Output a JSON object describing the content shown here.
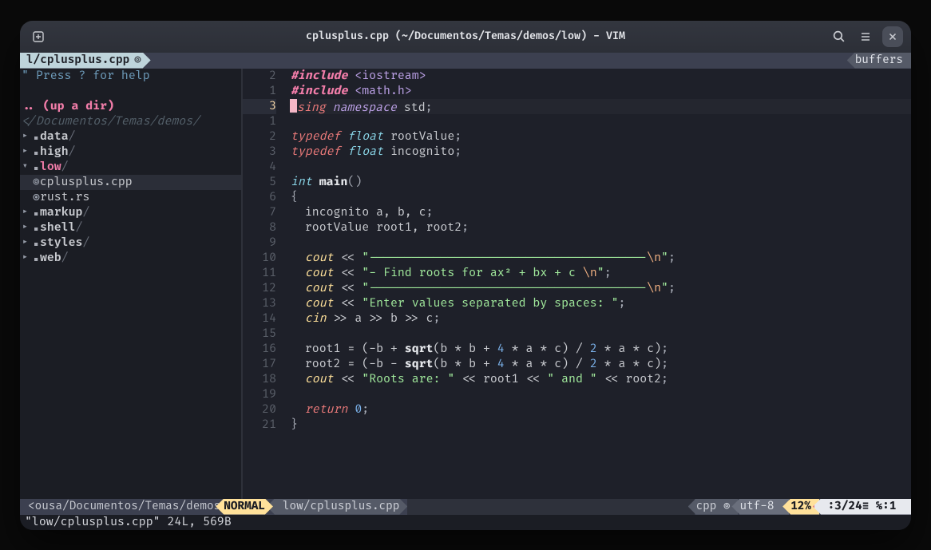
{
  "titlebar": {
    "title": "cplusplus.cpp (~/Documentos/Temas/demos/low) - VIM"
  },
  "tab": {
    "label": "l/cplusplus.cpp"
  },
  "buffers_label": "buffers",
  "sidebar": {
    "help": "\" Press ? for help",
    "up_label": ".. (up a dir)",
    "cwd_comment": "</Documentos/Temas/demos/",
    "items": [
      {
        "name": "data",
        "type": "folder",
        "open": false
      },
      {
        "name": "high",
        "type": "folder",
        "open": false
      },
      {
        "name": "low",
        "type": "folder",
        "open": true,
        "children": [
          {
            "name": "cplusplus.cpp",
            "type": "file",
            "sel": true,
            "ico": "⊚"
          },
          {
            "name": "rust.rs",
            "type": "file",
            "ico": "◉"
          }
        ]
      },
      {
        "name": "markup",
        "type": "folder",
        "open": false
      },
      {
        "name": "shell",
        "type": "folder",
        "open": false
      },
      {
        "name": "styles",
        "type": "folder",
        "open": false
      },
      {
        "name": "web",
        "type": "folder",
        "open": false
      }
    ]
  },
  "gutter": {
    "current_abs": 3,
    "rel": [
      2,
      1,
      "3",
      1,
      2,
      3,
      4,
      5,
      6,
      7,
      8,
      9,
      10,
      11,
      12,
      13,
      14,
      15,
      16,
      17,
      18,
      19,
      20,
      21,
      "",
      "",
      ""
    ]
  },
  "code": {
    "lines": [
      [
        [
          "k-inc",
          "#include"
        ],
        [
          "k-punc",
          " "
        ],
        [
          "k-hdr",
          "<iostream>"
        ]
      ],
      [
        [
          "k-inc",
          "#include"
        ],
        [
          "k-punc",
          " "
        ],
        [
          "k-hdr",
          "<math.h>"
        ]
      ],
      "__CURSOR_LINE__",
      [],
      [
        [
          "k-kw",
          "typedef"
        ],
        [
          "k-punc",
          " "
        ],
        [
          "k-type",
          "float"
        ],
        [
          "k-id",
          " rootValue"
        ],
        [
          "k-punc",
          ";"
        ]
      ],
      [
        [
          "k-kw",
          "typedef"
        ],
        [
          "k-punc",
          " "
        ],
        [
          "k-type",
          "float"
        ],
        [
          "k-id",
          " incognito"
        ],
        [
          "k-punc",
          ";"
        ]
      ],
      [],
      [
        [
          "k-type",
          "int"
        ],
        [
          "k-punc",
          " "
        ],
        [
          "k-fn",
          "main"
        ],
        [
          "k-punc",
          "()"
        ]
      ],
      [
        [
          "k-punc",
          "{"
        ]
      ],
      [
        [
          "k-id",
          "  incognito a, b, c"
        ],
        [
          "k-punc",
          ";"
        ]
      ],
      [
        [
          "k-id",
          "  rootValue root1, root2"
        ],
        [
          "k-punc",
          ";"
        ]
      ],
      [],
      [
        [
          "k-id",
          "  "
        ],
        [
          "k-out",
          "cout"
        ],
        [
          "k-op",
          " << "
        ],
        [
          "k-str",
          "\"---------------------------------------"
        ],
        [
          "k-esc",
          "\\n"
        ],
        [
          "k-str",
          "\""
        ],
        [
          "k-punc",
          ";"
        ]
      ],
      [
        [
          "k-id",
          "  "
        ],
        [
          "k-out",
          "cout"
        ],
        [
          "k-op",
          " << "
        ],
        [
          "k-str",
          "\"- Find roots for ax² + bx + c "
        ],
        [
          "k-esc",
          "\\n"
        ],
        [
          "k-str",
          "\""
        ],
        [
          "k-punc",
          ";"
        ]
      ],
      [
        [
          "k-id",
          "  "
        ],
        [
          "k-out",
          "cout"
        ],
        [
          "k-op",
          " << "
        ],
        [
          "k-str",
          "\"---------------------------------------"
        ],
        [
          "k-esc",
          "\\n"
        ],
        [
          "k-str",
          "\""
        ],
        [
          "k-punc",
          ";"
        ]
      ],
      [
        [
          "k-id",
          "  "
        ],
        [
          "k-out",
          "cout"
        ],
        [
          "k-op",
          " << "
        ],
        [
          "k-str",
          "\"Enter values separated by spaces: \""
        ],
        [
          "k-punc",
          ";"
        ]
      ],
      [
        [
          "k-id",
          "  "
        ],
        [
          "k-out",
          "cin"
        ],
        [
          "k-op",
          " >> a >> b >> c"
        ],
        [
          "k-punc",
          ";"
        ]
      ],
      [],
      [
        [
          "k-id",
          "  root1 = (-b + "
        ],
        [
          "k-fn",
          "sqrt"
        ],
        [
          "k-id",
          "(b * b + "
        ],
        [
          "k-num",
          "4"
        ],
        [
          "k-id",
          " * a * c) / "
        ],
        [
          "k-num",
          "2"
        ],
        [
          "k-id",
          " * a * c)"
        ],
        [
          "k-punc",
          ";"
        ]
      ],
      [
        [
          "k-id",
          "  root2 = (-b - "
        ],
        [
          "k-fn",
          "sqrt"
        ],
        [
          "k-id",
          "(b * b + "
        ],
        [
          "k-num",
          "4"
        ],
        [
          "k-id",
          " * a * c) / "
        ],
        [
          "k-num",
          "2"
        ],
        [
          "k-id",
          " * a * c)"
        ],
        [
          "k-punc",
          ";"
        ]
      ],
      [
        [
          "k-id",
          "  "
        ],
        [
          "k-out",
          "cout"
        ],
        [
          "k-op",
          " << "
        ],
        [
          "k-str",
          "\"Roots are: \""
        ],
        [
          "k-op",
          " << root1 << "
        ],
        [
          "k-str",
          "\" and \""
        ],
        [
          "k-op",
          " << root2"
        ],
        [
          "k-punc",
          ";"
        ]
      ],
      [],
      [
        [
          "k-id",
          "  "
        ],
        [
          "k-kw",
          "return"
        ],
        [
          "k-id",
          " "
        ],
        [
          "k-num",
          "0"
        ],
        [
          "k-punc",
          ";"
        ]
      ],
      [
        [
          "k-punc",
          "}"
        ]
      ],
      [],
      [],
      []
    ],
    "cursor_line": {
      "before": "",
      "char": "u",
      "rest": [
        [
          "k-kw",
          "sing"
        ],
        [
          "k-punc",
          " "
        ],
        [
          "k-ns",
          "namespace"
        ],
        [
          "k-id",
          " std"
        ],
        [
          "k-punc",
          ";"
        ]
      ]
    }
  },
  "status": {
    "cwd": "<ousa/Documentos/Temas/demos",
    "mode": "NORMAL",
    "file": "low/cplusplus.cpp",
    "ft": "cpp ⊚",
    "enc": "utf-8 ",
    "pct": "12%",
    "pos": " :3/24≡ ℅:1 "
  },
  "cmdline": "\"low/cplusplus.cpp\" 24L, 569B"
}
